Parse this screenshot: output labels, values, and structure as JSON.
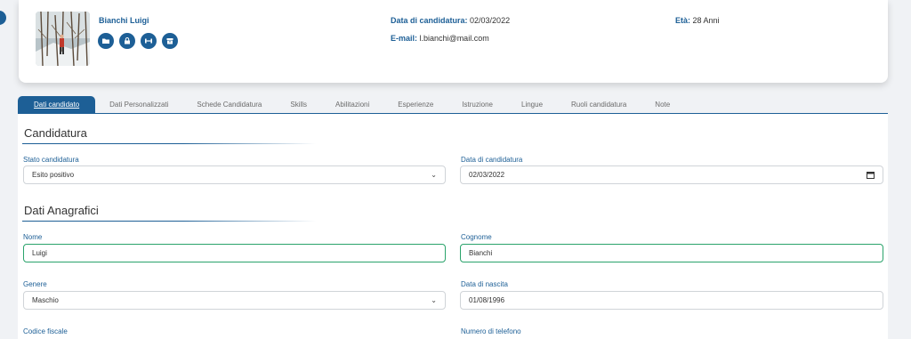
{
  "candidate": {
    "name": "Bianchi Luigi",
    "application_date_label": "Data di candidatura:",
    "application_date": "02/03/2022",
    "email_label": "E-mail:",
    "email": "l.bianchi@mail.com",
    "age_label": "Età:",
    "age": "28 Anni",
    "actions": [
      "folder-icon",
      "lock-icon",
      "dumbbell-icon",
      "archive-icon"
    ]
  },
  "tabs": [
    "Dati candidato",
    "Dati Personalizzati",
    "Schede Candidatura",
    "Skills",
    "Abilitazioni",
    "Esperienze",
    "Istruzione",
    "Lingue",
    "Ruoli candidatura",
    "Note"
  ],
  "candidatura": {
    "title": "Candidatura",
    "stato_label": "Stato candidatura",
    "stato_value": "Esito positivo",
    "data_label": "Data di candidatura",
    "data_value": "02/03/2022"
  },
  "anagrafici": {
    "title": "Dati Anagrafici",
    "nome_label": "Nome",
    "nome_value": "Luigi",
    "cognome_label": "Cognome",
    "cognome_value": "Bianchi",
    "genere_label": "Genere",
    "genere_value": "Maschio",
    "nascita_label": "Data di nascita",
    "nascita_value": "01/08/1996",
    "cf_label": "Codice fiscale",
    "tel_label": "Numero di telefono"
  },
  "colors": {
    "accent": "#1d5f96",
    "valid_border": "#2aa36b"
  }
}
